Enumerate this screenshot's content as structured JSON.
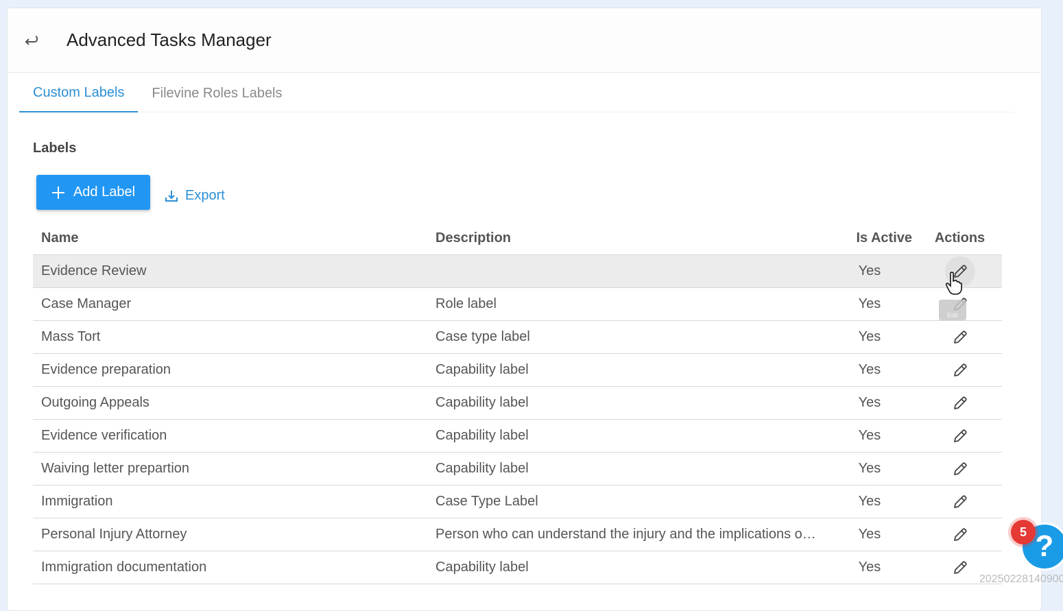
{
  "header": {
    "title": "Advanced Tasks Manager"
  },
  "tabs": [
    {
      "label": "Custom Labels",
      "active": true
    },
    {
      "label": "Filevine Roles Labels",
      "active": false
    }
  ],
  "section": {
    "title": "Labels"
  },
  "toolbar": {
    "add_label": "Add Label",
    "export_label": "Export"
  },
  "table": {
    "columns": {
      "name": "Name",
      "description": "Description",
      "is_active": "Is Active",
      "actions": "Actions"
    },
    "rows": [
      {
        "name": "Evidence Review",
        "description": "",
        "is_active": "Yes"
      },
      {
        "name": "Case Manager",
        "description": "Role label",
        "is_active": "Yes"
      },
      {
        "name": "Mass Tort",
        "description": "Case type label",
        "is_active": "Yes"
      },
      {
        "name": "Evidence preparation",
        "description": "Capability label",
        "is_active": "Yes"
      },
      {
        "name": "Outgoing Appeals",
        "description": "Capability label",
        "is_active": "Yes"
      },
      {
        "name": "Evidence verification",
        "description": "Capability label",
        "is_active": "Yes"
      },
      {
        "name": "Waiving letter prepartion",
        "description": "Capability label",
        "is_active": "Yes"
      },
      {
        "name": "Immigration",
        "description": "Case Type Label",
        "is_active": "Yes"
      },
      {
        "name": "Personal Injury Attorney",
        "description": "Person who can understand the injury and the implications of it",
        "is_active": "Yes"
      },
      {
        "name": "Immigration documentation",
        "description": "Capability label",
        "is_active": "Yes"
      }
    ]
  },
  "tooltip": {
    "text": "Edit"
  },
  "help": {
    "badge_count": "5",
    "icon": "?"
  },
  "build_id": "20250228140900",
  "colors": {
    "accent": "#2196f3",
    "link": "#2b8fd6",
    "badge": "#e53935",
    "help": "#1a9be6"
  }
}
